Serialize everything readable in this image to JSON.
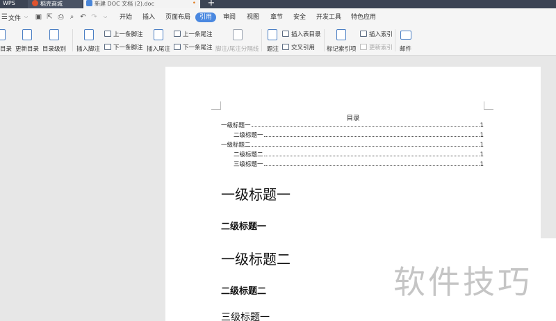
{
  "tabs": {
    "wps": "WPS",
    "store": "稻壳商城",
    "doc": "新建 DOC 文档 (2).doc",
    "doc_close": "•",
    "new_tab": "+"
  },
  "menubar": {
    "file": "文件",
    "items": [
      "开始",
      "插入",
      "页面布局",
      "引用",
      "审阅",
      "视图",
      "章节",
      "安全",
      "开发工具",
      "特色应用"
    ],
    "active_index": 3
  },
  "ribbon": {
    "toc": "目录",
    "update_toc": "更新目录",
    "toc_level": "目录级别",
    "insert_footnote": "插入脚注",
    "prev_footnote": "上一条脚注",
    "next_footnote": "下一条脚注",
    "insert_endnote": "插入尾注",
    "prev_endnote": "上一条尾注",
    "next_endnote": "下一条尾注",
    "footnote_separator": "脚注/尾注分隔线",
    "caption": "题注",
    "insert_table_of_figures": "插入表目录",
    "cross_reference": "交叉引用",
    "mark_index_entry": "标记索引项",
    "insert_index": "插入索引",
    "update_index": "更新索引",
    "mail": "邮件"
  },
  "document": {
    "toc_title": "目录",
    "toc_entries": [
      {
        "label": "一级标题一",
        "page": "1",
        "level": 1
      },
      {
        "label": "二级标题一",
        "page": "1",
        "level": 2
      },
      {
        "label": "一级标题二",
        "page": "1",
        "level": 1
      },
      {
        "label": "二级标题二",
        "page": "1",
        "level": 2
      },
      {
        "label": "三级标题一",
        "page": "1",
        "level": 2
      }
    ],
    "headings": [
      {
        "text": "一级标题一",
        "style": "h1"
      },
      {
        "text": "二级标题一",
        "style": "h2"
      },
      {
        "text": "一级标题二",
        "style": "h1"
      },
      {
        "text": "二级标题二",
        "style": "h2"
      },
      {
        "text": "三级标题一",
        "style": "h3"
      }
    ]
  },
  "watermark": "软件技巧",
  "colors": {
    "tabbar": "#3c4454",
    "active_menu": "#4a88e0",
    "ribbon_bg": "#f5f5f5",
    "workspace_bg": "#e7e7e7",
    "watermark": "#c5c5c5"
  }
}
